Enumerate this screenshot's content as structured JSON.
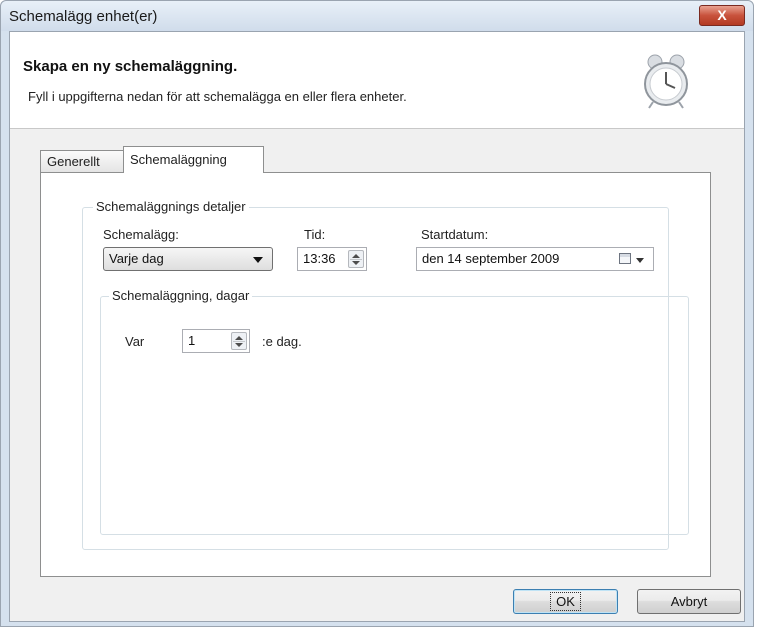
{
  "window": {
    "title": "Schemalägg enhet(er)",
    "close_label": "X"
  },
  "header": {
    "title": "Skapa en ny schemaläggning.",
    "subtitle": "Fyll i uppgifterna nedan för att schemalägga en eller flera enheter.",
    "icon": "alarm-clock-icon"
  },
  "tabs": [
    {
      "label": "Generellt"
    },
    {
      "label": "Schemaläggning"
    }
  ],
  "details": {
    "group_title": "Schemaläggnings detaljer",
    "schedule_label": "Schemalägg:",
    "schedule_value": "Varje dag",
    "time_label": "Tid:",
    "time_value": "13:36",
    "startdate_label": "Startdatum:",
    "startdate_value": "den 14 september 2009"
  },
  "days": {
    "group_title": "Schemaläggning, dagar",
    "every_label": "Var",
    "interval_value": "1",
    "suffix_label": ":e dag."
  },
  "footer": {
    "ok_label": "OK",
    "cancel_label": "Avbryt"
  }
}
